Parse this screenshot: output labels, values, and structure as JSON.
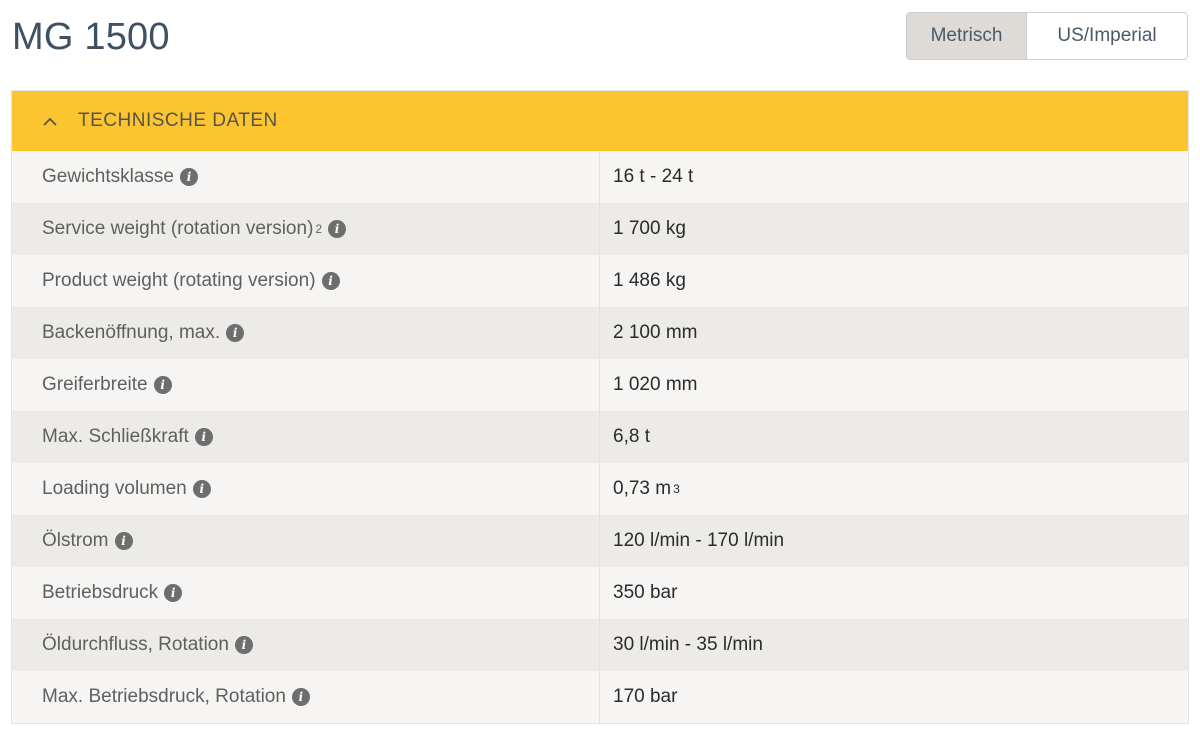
{
  "header": {
    "title": "MG 1500",
    "unit_toggle": {
      "options": [
        "Metrisch",
        "US/Imperial"
      ],
      "selected": "Metrisch"
    }
  },
  "panel": {
    "title": "TECHNISCHE DATEN",
    "expanded": true,
    "header_color": "#fcc42e",
    "collapse_icon": "chevron-up-icon",
    "info_icon": "info-icon",
    "rows": [
      {
        "label": "Gewichtsklasse",
        "value": "16 t - 24 t",
        "value_sup": ""
      },
      {
        "label": "Service weight (rotation version)",
        "label_sup": "2",
        "value": "1 700 kg",
        "value_sup": ""
      },
      {
        "label": "Product weight (rotating version)",
        "value": "1 486 kg",
        "value_sup": ""
      },
      {
        "label": "Backenöffnung, max.",
        "value": "2 100 mm",
        "value_sup": ""
      },
      {
        "label": "Greiferbreite",
        "value": "1 020 mm",
        "value_sup": ""
      },
      {
        "label": "Max. Schließkraft",
        "value": "6,8 t",
        "value_sup": ""
      },
      {
        "label": "Loading volumen",
        "value": "0,73 m",
        "value_sup": "3"
      },
      {
        "label": "Ölstrom",
        "value": "120 l/min - 170 l/min",
        "value_sup": ""
      },
      {
        "label": "Betriebsdruck",
        "value": "350 bar",
        "value_sup": ""
      },
      {
        "label": "Öldurchfluss, Rotation",
        "value": "30 l/min - 35 l/min",
        "value_sup": ""
      },
      {
        "label": "Max. Betriebsdruck, Rotation",
        "value": "170 bar",
        "value_sup": ""
      }
    ]
  }
}
